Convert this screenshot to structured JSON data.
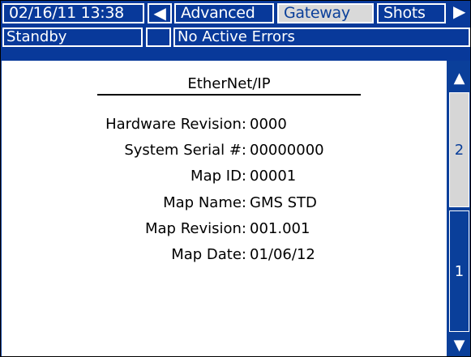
{
  "header": {
    "datetime": "02/16/11 13:38",
    "left_arrow": "🡄",
    "tabs": [
      {
        "label": "Advanced",
        "selected": false
      },
      {
        "label": "Gateway",
        "selected": true
      },
      {
        "label": "Shots",
        "selected": false
      }
    ],
    "right_arrow": "🡆"
  },
  "status": {
    "mode": "Standby",
    "blank": "",
    "errors": "No Active Errors"
  },
  "main": {
    "title": "EtherNet/IP",
    "rows": [
      {
        "label": "Hardware Revision:",
        "value": "0000"
      },
      {
        "label": "System Serial #:",
        "value": "00000000"
      },
      {
        "label": "Map ID:",
        "value": "00001"
      },
      {
        "label": "Map Name:",
        "value": "GMS STD"
      },
      {
        "label": "Map  Revision:",
        "value": "001.001"
      },
      {
        "label": "Map Date:",
        "value": "01/06/12"
      }
    ]
  },
  "scroll": {
    "up_icon": "arrow-up-icon",
    "down_icon": "arrow-down-icon",
    "pages": [
      {
        "label": "2",
        "selected": true
      },
      {
        "label": "1",
        "selected": false
      }
    ]
  },
  "colors": {
    "primary_blue": "#0a3f9a",
    "selected_gray": "#d9d9d9",
    "text": "#000000"
  }
}
